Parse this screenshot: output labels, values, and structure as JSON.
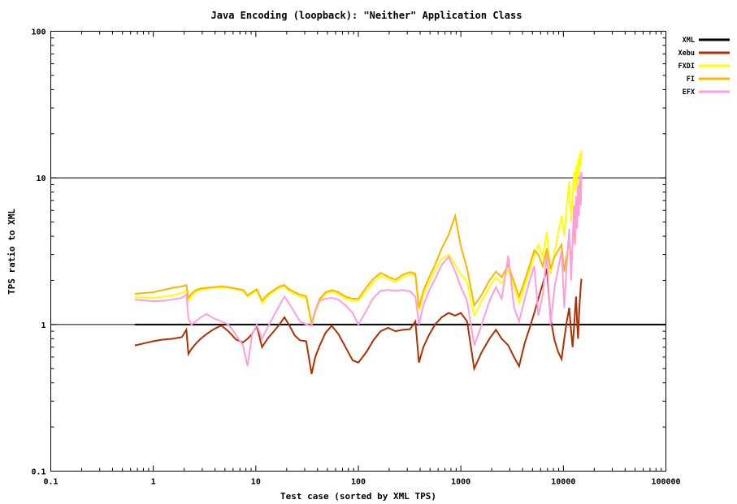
{
  "chart_data": {
    "type": "line",
    "title": "Java Encoding (loopback): \"Neither\" Application Class",
    "xlabel": "Test case (sorted by XML TPS)",
    "ylabel": "TPS ratio to XML",
    "xscale": "log",
    "yscale": "log",
    "xlim": [
      0.1,
      100000
    ],
    "ylim": [
      0.1,
      100
    ],
    "xticks": [
      "0.1",
      "1",
      "10",
      "100",
      "1000",
      "10000",
      "100000"
    ],
    "xtick_values": [
      0.1,
      1,
      10,
      100,
      1000,
      10000,
      100000
    ],
    "yticks": [
      "0.1",
      "1",
      "10",
      "100"
    ],
    "ytick_values": [
      0.1,
      1,
      10,
      100
    ],
    "grid": false,
    "gridlines_y": [
      1,
      10
    ],
    "legend_position": "top-right-outside",
    "colors": {
      "XML": "#000000",
      "Xebu": "#b03000",
      "FXDI": "#ffff00",
      "FI": "#ffb400",
      "EFX": "#ff9edd"
    },
    "series": [
      {
        "name": "XML",
        "color": "#000000",
        "x": [
          0.66,
          100000
        ],
        "values": [
          1.0,
          1.0
        ]
      },
      {
        "name": "Xebu",
        "color": "#b03000",
        "x": [
          0.66,
          0.82,
          1.0,
          1.25,
          1.55,
          1.9,
          2.1,
          2.2,
          2.35,
          2.6,
          2.9,
          3.3,
          3.9,
          4.6,
          5.4,
          6.4,
          7.5,
          8.3,
          9.2,
          10.2,
          11.5,
          13,
          15,
          17,
          19,
          21,
          24,
          27,
          31,
          35,
          38,
          42,
          48,
          55,
          64,
          75,
          88,
          100,
          120,
          140,
          165,
          195,
          230,
          270,
          320,
          360,
          390,
          430,
          490,
          560,
          650,
          760,
          880,
          1000,
          1150,
          1350,
          1600,
          1900,
          2200,
          2500,
          2900,
          3300,
          3700,
          4200,
          4700,
          5200,
          5700,
          6300,
          6900,
          7500,
          8200,
          8900,
          9600,
          10200,
          10800,
          11400,
          11900,
          12300,
          12700,
          13000,
          13300,
          13600,
          13900,
          14200,
          14500,
          14800,
          15000
        ],
        "values": [
          0.72,
          0.745,
          0.77,
          0.79,
          0.8,
          0.82,
          0.92,
          0.63,
          0.68,
          0.74,
          0.8,
          0.86,
          0.93,
          0.985,
          0.9,
          0.79,
          0.755,
          0.8,
          0.86,
          0.98,
          0.7,
          0.8,
          0.9,
          1.0,
          1.12,
          1.0,
          0.84,
          0.78,
          0.77,
          0.46,
          0.6,
          0.72,
          0.88,
          0.98,
          0.86,
          0.7,
          0.57,
          0.55,
          0.65,
          0.78,
          0.9,
          0.95,
          0.9,
          0.92,
          0.93,
          1.05,
          0.55,
          0.7,
          0.85,
          1.0,
          1.12,
          1.2,
          1.15,
          1.2,
          1.05,
          0.5,
          0.65,
          0.8,
          0.92,
          0.8,
          0.72,
          0.6,
          0.52,
          0.75,
          0.95,
          1.2,
          1.5,
          1.9,
          2.4,
          1.1,
          0.78,
          0.65,
          0.58,
          0.8,
          1.05,
          1.3,
          0.9,
          0.7,
          0.95,
          1.25,
          1.55,
          1.05,
          0.8,
          1.15,
          1.5,
          1.85,
          2.05,
          1.1
        ]
      },
      {
        "name": "FXDI",
        "color": "#ffff00",
        "x": [
          0.66,
          0.82,
          1.0,
          1.25,
          1.55,
          1.9,
          2.1,
          2.2,
          2.35,
          2.6,
          2.9,
          3.3,
          3.9,
          4.6,
          5.4,
          6.4,
          7.5,
          8.3,
          9.2,
          10.2,
          11.5,
          13,
          15,
          17,
          19,
          21,
          24,
          27,
          31,
          35,
          38,
          42,
          48,
          55,
          64,
          75,
          88,
          100,
          120,
          140,
          165,
          195,
          230,
          270,
          320,
          360,
          390,
          430,
          490,
          560,
          650,
          760,
          880,
          1000,
          1150,
          1350,
          1600,
          1900,
          2200,
          2500,
          2900,
          3300,
          3700,
          4200,
          4700,
          5200,
          5700,
          6300,
          6900,
          7500,
          8200,
          8900,
          9600,
          10200,
          10800,
          11400,
          11900,
          12300,
          12700,
          13000,
          13300,
          13600,
          13900,
          14200,
          14500,
          14800,
          15000
        ],
        "values": [
          1.55,
          1.53,
          1.52,
          1.55,
          1.58,
          1.65,
          1.7,
          1.45,
          1.55,
          1.68,
          1.72,
          1.75,
          1.78,
          1.8,
          1.78,
          1.74,
          1.7,
          1.55,
          1.62,
          1.72,
          1.4,
          1.55,
          1.68,
          1.78,
          1.82,
          1.7,
          1.62,
          1.55,
          1.52,
          1.0,
          1.2,
          1.45,
          1.62,
          1.68,
          1.62,
          1.5,
          1.45,
          1.45,
          1.7,
          1.95,
          2.15,
          2.05,
          1.95,
          2.1,
          2.2,
          2.15,
          1.25,
          1.6,
          1.95,
          2.35,
          2.8,
          3.0,
          2.55,
          2.2,
          1.95,
          1.15,
          1.45,
          1.8,
          2.1,
          1.9,
          2.35,
          1.8,
          1.4,
          1.85,
          2.35,
          2.95,
          3.5,
          2.9,
          4.3,
          2.2,
          3.1,
          4.2,
          5.5,
          4.0,
          6.5,
          9.5,
          5.0,
          7.5,
          11.0,
          8.0,
          12.0,
          9.0,
          13.5,
          10.5,
          14.8,
          12.0,
          15.5
        ]
      },
      {
        "name": "FI",
        "color": "#ffb400",
        "x": [
          0.66,
          0.82,
          1.0,
          1.25,
          1.55,
          1.9,
          2.1,
          2.2,
          2.35,
          2.6,
          2.9,
          3.3,
          3.9,
          4.6,
          5.4,
          6.4,
          7.5,
          8.3,
          9.2,
          10.2,
          11.5,
          13,
          15,
          17,
          19,
          21,
          24,
          27,
          31,
          35,
          38,
          42,
          48,
          55,
          64,
          75,
          88,
          100,
          120,
          140,
          165,
          195,
          230,
          270,
          320,
          360,
          390,
          430,
          490,
          560,
          650,
          760,
          880,
          1000,
          1150,
          1350,
          1600,
          1900,
          2200,
          2500,
          2900,
          3300,
          3700,
          4200,
          4700,
          5200,
          5700,
          6300,
          6900,
          7500,
          8200,
          8900,
          9600,
          10200,
          10800,
          11400,
          11900,
          12300,
          12700,
          13000,
          13300,
          13600,
          13900,
          14200,
          14500,
          14800,
          15000
        ],
        "values": [
          1.62,
          1.64,
          1.66,
          1.72,
          1.78,
          1.82,
          1.86,
          1.52,
          1.62,
          1.72,
          1.76,
          1.78,
          1.8,
          1.82,
          1.8,
          1.76,
          1.72,
          1.58,
          1.66,
          1.74,
          1.46,
          1.6,
          1.72,
          1.82,
          1.86,
          1.74,
          1.66,
          1.6,
          1.56,
          1.02,
          1.25,
          1.5,
          1.66,
          1.72,
          1.66,
          1.55,
          1.5,
          1.5,
          1.8,
          2.05,
          2.25,
          2.12,
          2.02,
          2.18,
          2.28,
          2.22,
          1.3,
          1.7,
          2.1,
          2.55,
          3.3,
          4.1,
          5.5,
          3.4,
          2.4,
          1.35,
          1.6,
          2.0,
          2.3,
          2.1,
          2.55,
          1.95,
          1.55,
          2.0,
          2.55,
          3.2,
          3.0,
          2.5,
          3.3,
          2.4,
          2.9,
          3.2,
          3.5,
          2.3,
          3.0,
          3.6,
          2.8,
          3.5,
          4.5,
          5.5,
          7.0,
          6.0,
          8.5,
          7.5,
          10.0,
          8.0,
          9.0
        ]
      },
      {
        "name": "EFX",
        "color": "#ff9edd",
        "x": [
          0.66,
          0.82,
          1.0,
          1.25,
          1.55,
          1.9,
          2.1,
          2.2,
          2.35,
          2.6,
          2.9,
          3.3,
          3.9,
          4.6,
          5.4,
          6.4,
          7.5,
          8.3,
          9.2,
          10.2,
          11.5,
          13,
          15,
          17,
          19,
          21,
          24,
          27,
          31,
          35,
          38,
          42,
          48,
          55,
          64,
          75,
          88,
          100,
          120,
          140,
          165,
          195,
          230,
          270,
          320,
          360,
          390,
          430,
          490,
          560,
          650,
          760,
          880,
          1000,
          1150,
          1350,
          1600,
          1900,
          2200,
          2500,
          2900,
          3300,
          3700,
          4200,
          4700,
          5200,
          5700,
          6300,
          6900,
          7500,
          8200,
          8900,
          9600,
          10200,
          10800,
          11400,
          11900,
          12300,
          12700,
          13000,
          13300,
          13600,
          13900,
          14200,
          14500,
          14800,
          15000
        ],
        "values": [
          1.48,
          1.46,
          1.44,
          1.45,
          1.48,
          1.52,
          1.6,
          1.1,
          1.0,
          1.05,
          1.12,
          1.18,
          1.1,
          1.05,
          1.0,
          0.85,
          0.72,
          0.52,
          0.85,
          1.0,
          0.8,
          0.95,
          1.15,
          1.35,
          1.55,
          1.4,
          1.2,
          1.05,
          1.0,
          0.98,
          1.25,
          1.45,
          1.5,
          1.52,
          1.48,
          1.35,
          1.2,
          1.0,
          1.25,
          1.52,
          1.7,
          1.72,
          1.7,
          1.72,
          1.68,
          1.55,
          1.0,
          1.35,
          1.7,
          2.05,
          2.55,
          2.9,
          2.3,
          1.8,
          1.45,
          0.72,
          1.0,
          1.45,
          1.8,
          1.5,
          2.95,
          1.3,
          1.05,
          1.5,
          2.0,
          2.5,
          1.15,
          1.6,
          3.05,
          1.0,
          1.8,
          2.4,
          3.2,
          1.3,
          2.6,
          4.5,
          2.0,
          3.8,
          6.5,
          3.5,
          7.5,
          4.5,
          9.0,
          5.5,
          10.5,
          6.5,
          11.0
        ]
      }
    ],
    "legend": [
      {
        "label": "XML",
        "color": "#000000"
      },
      {
        "label": "Xebu",
        "color": "#b03000"
      },
      {
        "label": "FXDI",
        "color": "#ffff00"
      },
      {
        "label": "FI",
        "color": "#ffb400"
      },
      {
        "label": "EFX",
        "color": "#ff9edd"
      }
    ]
  }
}
